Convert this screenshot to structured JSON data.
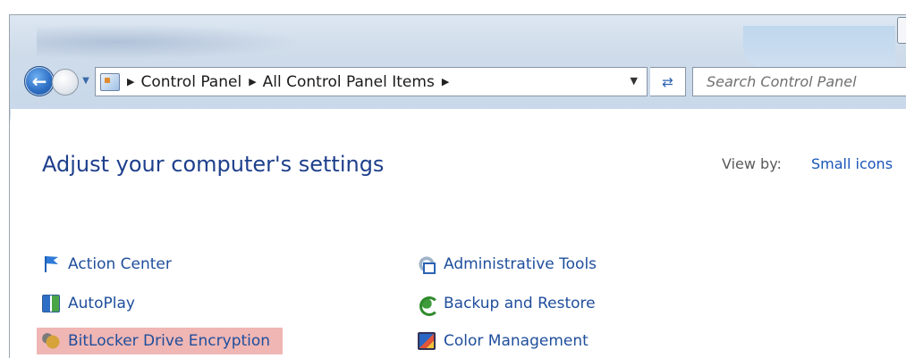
{
  "navigation": {
    "back_icon": "back-arrow-icon",
    "forward_icon": "forward-arrow-icon",
    "history_dropdown_icon": "chevron-down-icon"
  },
  "address_bar": {
    "icon": "control-panel-icon",
    "breadcrumbs": [
      "Control Panel",
      "All Control Panel Items"
    ],
    "dropdown_icon": "chevron-down-icon"
  },
  "refresh": {
    "icon": "refresh-icon"
  },
  "search": {
    "placeholder": "Search Control Panel",
    "value": ""
  },
  "main": {
    "title": "Adjust your computer's settings",
    "view_by_label": "View by:",
    "view_by_value": "Small icons"
  },
  "items": {
    "left": [
      {
        "label": "Action Center",
        "icon": "flag-icon"
      },
      {
        "label": "AutoPlay",
        "icon": "autoplay-icon"
      },
      {
        "label": "BitLocker Drive Encryption",
        "icon": "bitlocker-icon",
        "highlighted": true
      }
    ],
    "right": [
      {
        "label": "Administrative Tools",
        "icon": "administrative-tools-icon"
      },
      {
        "label": "Backup and Restore",
        "icon": "backup-restore-icon"
      },
      {
        "label": "Color Management",
        "icon": "color-management-icon"
      }
    ]
  },
  "colors": {
    "title": "#1e3f8c",
    "link": "#1f4e9c",
    "highlight": "#efb6b4"
  }
}
